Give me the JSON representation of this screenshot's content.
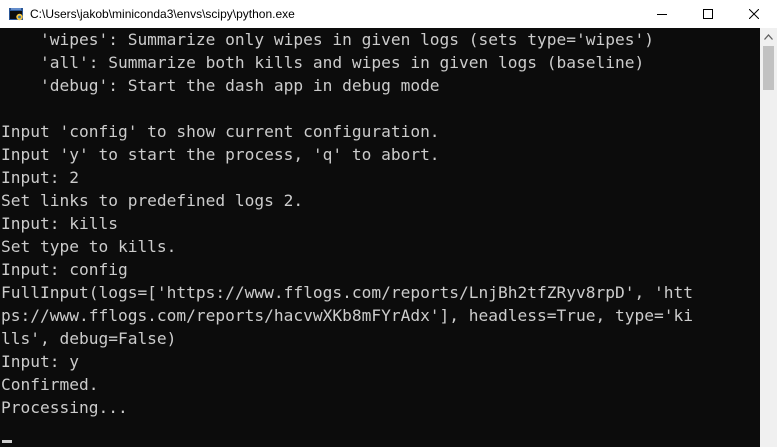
{
  "window": {
    "title": "C:\\Users\\jakob\\miniconda3\\envs\\scipy\\python.exe",
    "icon": "python-console-icon"
  },
  "caption_buttons": {
    "minimize": "minimize-icon",
    "maximize": "maximize-icon",
    "close": "close-icon"
  },
  "terminal": {
    "lines": [
      "    'wipes': Summarize only wipes in given logs (sets type='wipes')",
      "    'all': Summarize both kills and wipes in given logs (baseline)",
      "    'debug': Start the dash app in debug mode",
      "",
      "Input 'config' to show current configuration.",
      "Input 'y' to start the process, 'q' to abort.",
      "Input: 2",
      "Set links to predefined logs 2.",
      "Input: kills",
      "Set type to kills.",
      "Input: config",
      "FullInput(logs=['https://www.fflogs.com/reports/LnjBh2tfZRyv8rpD', 'htt",
      "ps://www.fflogs.com/reports/hacvwXKb8mFYrAdx'], headless=True, type='ki",
      "lls', debug=False)",
      "Input: y",
      "Confirmed.",
      "Processing..."
    ]
  },
  "colors": {
    "background": "#0c0c0c",
    "foreground": "#cccccc",
    "titlebar": "#ffffff"
  }
}
